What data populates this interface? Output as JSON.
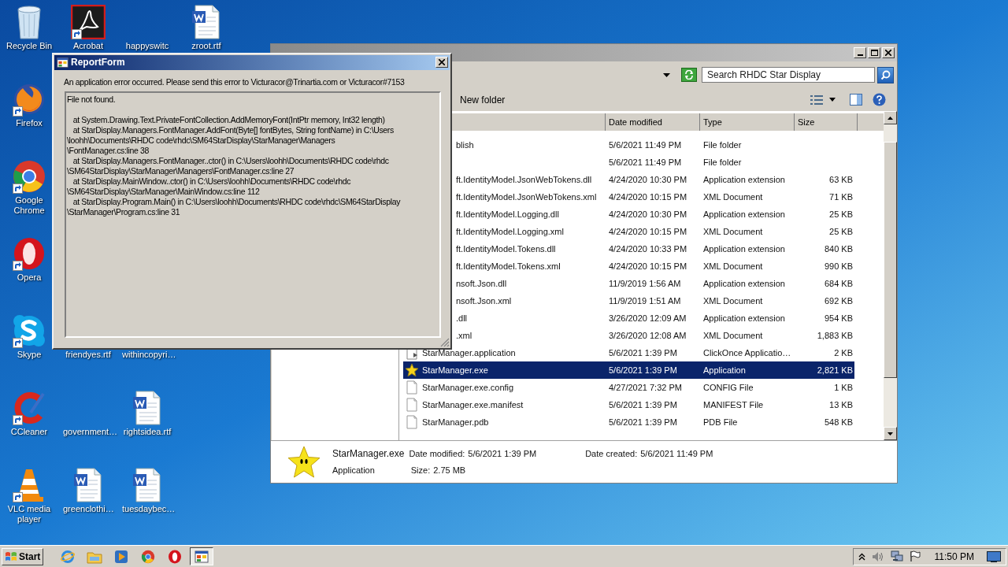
{
  "desktop": {
    "icons": [
      {
        "label": "Recycle Bin",
        "kind": "recycle",
        "shortcut": false
      },
      {
        "label": "Acrobat",
        "kind": "acrobat",
        "shortcut": true
      },
      {
        "label": "happyswitc",
        "kind": "none",
        "shortcut": false
      },
      {
        "label": "zroot.rtf",
        "kind": "word",
        "shortcut": false
      },
      {
        "label": "Firefox",
        "kind": "firefox",
        "shortcut": true
      },
      {
        "label": "Google Chrome",
        "kind": "chrome",
        "shortcut": true
      },
      {
        "label": "Opera",
        "kind": "opera",
        "shortcut": true
      },
      {
        "label": "Skype",
        "kind": "skype",
        "shortcut": true
      },
      {
        "label": "friendyes.rtf",
        "kind": "none"
      },
      {
        "label": "withincopyri…",
        "kind": "none"
      },
      {
        "label": "CCleaner",
        "kind": "ccleaner",
        "shortcut": true
      },
      {
        "label": "government…",
        "kind": "none",
        "shortcut": false
      },
      {
        "label": "rightsidea.rtf",
        "kind": "word",
        "shortcut": false
      },
      {
        "label": "VLC media player",
        "kind": "vlc",
        "shortcut": true
      },
      {
        "label": "greenclothi…",
        "kind": "word",
        "shortcut": false
      },
      {
        "label": "tuesdaybec…",
        "kind": "word",
        "shortcut": false
      }
    ]
  },
  "explorer": {
    "search": {
      "placeholder": "Search RHDC Star Display"
    },
    "toolbar": {
      "new_folder": "New folder"
    },
    "columns": [
      "Date modified",
      "Type",
      "Size"
    ],
    "rows": [
      {
        "kind": "covered",
        "name": "blish",
        "date": "5/6/2021 11:49 PM",
        "type": "File folder",
        "selected": false
      },
      {
        "kind": "covered",
        "date": "5/6/2021 11:49 PM",
        "type": "File folder",
        "selected": false
      },
      {
        "kind": "covered",
        "name": "ft.IdentityModel.JsonWebTokens.dll",
        "date": "4/24/2020 10:30 PM",
        "type": "Application extension",
        "size": "63 KB",
        "selected": false
      },
      {
        "kind": "covered",
        "name": "ft.IdentityModel.JsonWebTokens.xml",
        "date": "4/24/2020 10:15 PM",
        "type": "XML Document",
        "size": "71 KB",
        "selected": false
      },
      {
        "kind": "covered",
        "name": "ft.IdentityModel.Logging.dll",
        "date": "4/24/2020 10:30 PM",
        "type": "Application extension",
        "size": "25 KB",
        "selected": false
      },
      {
        "kind": "covered",
        "name": "ft.IdentityModel.Logging.xml",
        "date": "4/24/2020 10:15 PM",
        "type": "XML Document",
        "size": "25 KB",
        "selected": false
      },
      {
        "kind": "covered",
        "name": "ft.IdentityModel.Tokens.dll",
        "date": "4/24/2020 10:33 PM",
        "type": "Application extension",
        "size": "840 KB",
        "selected": false
      },
      {
        "kind": "covered",
        "name": "ft.IdentityModel.Tokens.xml",
        "date": "4/24/2020 10:15 PM",
        "type": "XML Document",
        "size": "990 KB",
        "selected": false
      },
      {
        "kind": "covered",
        "name": "nsoft.Json.dll",
        "date": "11/9/2019 1:56 AM",
        "type": "Application extension",
        "size": "684 KB",
        "selected": false
      },
      {
        "kind": "covered",
        "name": "nsoft.Json.xml",
        "date": "11/9/2019 1:51 AM",
        "type": "XML Document",
        "size": "692 KB",
        "selected": false
      },
      {
        "kind": "covered",
        "name": ".dll",
        "date": "3/26/2020 12:09 AM",
        "type": "Application extension",
        "size": "954 KB",
        "selected": false
      },
      {
        "kind": "covered",
        "name": ".xml",
        "date": "3/26/2020 12:08 AM",
        "type": "XML Document",
        "size": "1,883 KB",
        "selected": false
      },
      {
        "kind": "application",
        "name": "StarManager.application",
        "date": "5/6/2021 1:39 PM",
        "type": "ClickOnce Applicatio…",
        "size": "2 KB",
        "selected": false
      },
      {
        "kind": "exe",
        "name": "StarManager.exe",
        "date": "5/6/2021 1:39 PM",
        "type": "Application",
        "size": "2,821 KB",
        "selected": true
      },
      {
        "kind": "file",
        "name": "StarManager.exe.config",
        "date": "4/27/2021 7:32 PM",
        "type": "CONFIG File",
        "size": "1 KB",
        "selected": false
      },
      {
        "kind": "file",
        "name": "StarManager.exe.manifest",
        "date": "5/6/2021 1:39 PM",
        "type": "MANIFEST File",
        "size": "13 KB",
        "selected": false
      },
      {
        "kind": "file",
        "name": "StarManager.pdb",
        "date": "5/6/2021 1:39 PM",
        "type": "PDB File",
        "size": "548 KB",
        "selected": false
      }
    ],
    "details": {
      "name": "StarManager.exe",
      "type": "Application",
      "modified_label": "Date modified:",
      "modified": "5/6/2021 1:39 PM",
      "created_label": "Date created:",
      "created": "5/6/2021 11:49 PM",
      "size_label": "Size:",
      "size": "2.75 MB"
    }
  },
  "report_form": {
    "title": "ReportForm",
    "message": "An application error occurred. Please send this error to Victuracor@Trinartia.com or Victuracor#7153",
    "blocks": [
      {
        "lines": [
          "File not found."
        ]
      },
      {
        "lines": [
          "   at System.Drawing.Text.PrivateFontCollection.AddMemoryFont(IntPtr memory, Int32 length)",
          "   at StarDisplay.Managers.FontManager.AddFont(Byte[] fontBytes, String fontName) in C:\\Users",
          "\\loohh\\Documents\\RHDC code\\rhdc\\SM64StarDisplay\\StarManager\\Managers",
          "\\FontManager.cs:line 38",
          "   at StarDisplay.Managers.FontManager..ctor() in C:\\Users\\loohh\\Documents\\RHDC code\\rhdc",
          "\\SM64StarDisplay\\StarManager\\Managers\\FontManager.cs:line 27",
          "   at StarDisplay.MainWindow..ctor() in C:\\Users\\loohh\\Documents\\RHDC code\\rhdc",
          "\\SM64StarDisplay\\StarManager\\MainWindow.cs:line 112",
          "   at StarDisplay.Program.Main() in C:\\Users\\loohh\\Documents\\RHDC code\\rhdc\\SM64StarDisplay",
          "\\StarManager\\Program.cs:line 31"
        ]
      }
    ]
  },
  "taskbar": {
    "start": "Start",
    "apps": [
      {
        "kind": "ie",
        "active": false
      },
      {
        "kind": "explorer",
        "active": false
      },
      {
        "kind": "media",
        "active": false
      },
      {
        "kind": "chrome",
        "active": false
      },
      {
        "kind": "opera",
        "active": false
      },
      {
        "kind": "form",
        "active": true
      }
    ],
    "clock": "11:50 PM"
  }
}
